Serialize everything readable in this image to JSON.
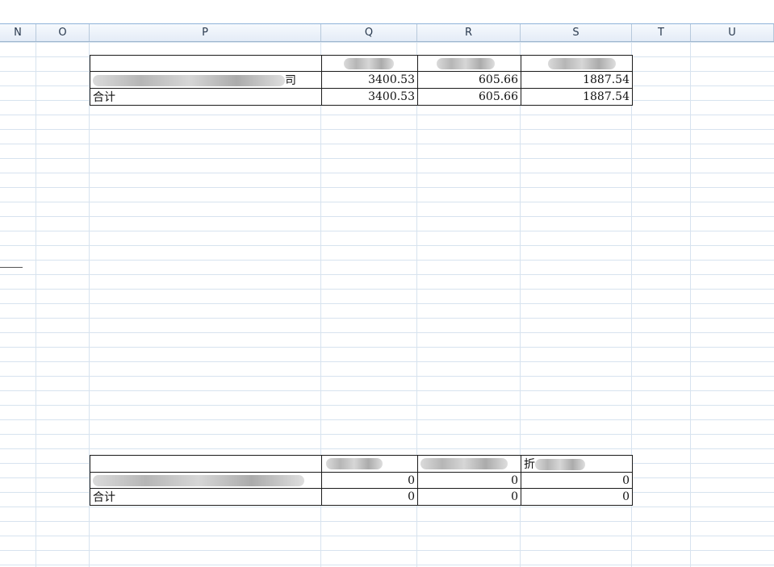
{
  "columns": [
    "N",
    "O",
    "P",
    "Q",
    "R",
    "S",
    "T",
    "U"
  ],
  "table1": {
    "row1": {
      "label": "",
      "q": "",
      "r": "",
      "s": ""
    },
    "row2": {
      "label_tail": "司",
      "q": "3400.53",
      "r": "605.66",
      "s": "1887.54"
    },
    "row3": {
      "label": "合计",
      "q": "3400.53",
      "r": "605.66",
      "s": "1887.54"
    }
  },
  "table2": {
    "row1": {
      "s_prefix": "折"
    },
    "row2": {
      "q": "0",
      "r": "0",
      "s": "0"
    },
    "row3": {
      "label": "合计",
      "q": "0",
      "r": "0",
      "s": "0"
    }
  }
}
